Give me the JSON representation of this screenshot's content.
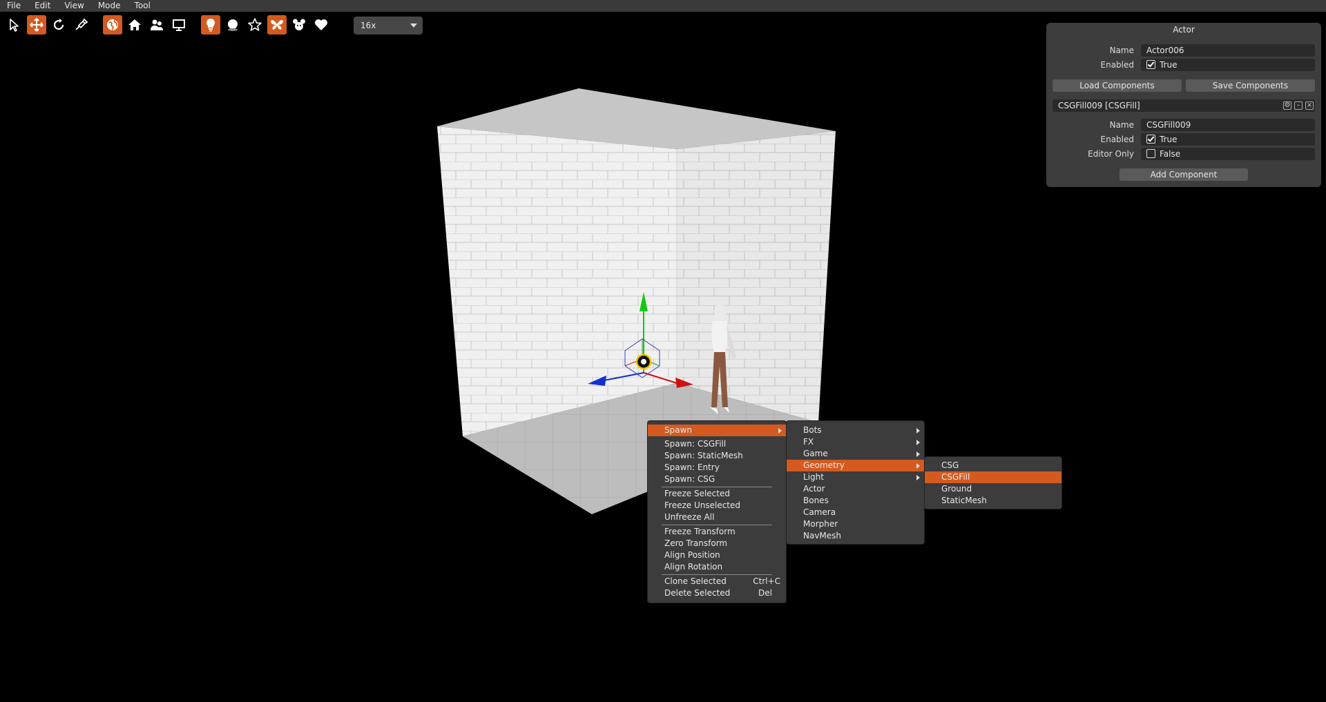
{
  "menubar": {
    "items": [
      "File",
      "Edit",
      "View",
      "Mode",
      "Tool"
    ]
  },
  "toolbar": {
    "zoom_value": "16x",
    "buttons": [
      "select-arrow-icon",
      "move-icon",
      "rotate-icon",
      "paint-icon",
      "globe-icon",
      "home-icon",
      "people-icon",
      "monitor-icon",
      "lightbulb-icon",
      "sphere-icon",
      "star-icon",
      "butterfly-icon",
      "mouse-icon",
      "heart-icon"
    ]
  },
  "actor_panel": {
    "title": "Actor",
    "name_label": "Name",
    "name_value": "Actor006",
    "enabled_label": "Enabled",
    "enabled_value": "True",
    "load_button": "Load Components",
    "save_button": "Save Components",
    "component_header": "CSGFill009 [CSGFill]",
    "comp_name_label": "Name",
    "comp_name_value": "CSGFill009",
    "comp_enabled_label": "Enabled",
    "comp_enabled_value": "True",
    "editor_only_label": "Editor Only",
    "editor_only_value": "False",
    "add_component_button": "Add Component"
  },
  "context_menu": {
    "spawn": "Spawn",
    "spawn_csgfill": "Spawn: CSGFill",
    "spawn_staticmesh": "Spawn: StaticMesh",
    "spawn_entry": "Spawn: Entry",
    "spawn_csg": "Spawn: CSG",
    "freeze_selected": "Freeze Selected",
    "freeze_unselected": "Freeze Unselected",
    "unfreeze_all": "Unfreeze All",
    "freeze_transform": "Freeze Transform",
    "zero_transform": "Zero Transform",
    "align_position": "Align Position",
    "align_rotation": "Align Rotation",
    "clone_selected": "Clone Selected",
    "clone_shortcut": "Ctrl+C",
    "delete_selected": "Delete Selected",
    "delete_shortcut": "Del"
  },
  "spawn_submenu": {
    "items": [
      "Bots",
      "FX",
      "Game",
      "Geometry",
      "Light",
      "Actor",
      "Bones",
      "Camera",
      "Morpher",
      "NavMesh"
    ]
  },
  "geometry_submenu": {
    "items": [
      "CSG",
      "CSGFill",
      "Ground",
      "StaticMesh"
    ]
  },
  "colors": {
    "accent": "#d45a1f",
    "panel": "#3d3d3d",
    "field": "#2a2a2a",
    "menubar": "#3a3a3a"
  }
}
